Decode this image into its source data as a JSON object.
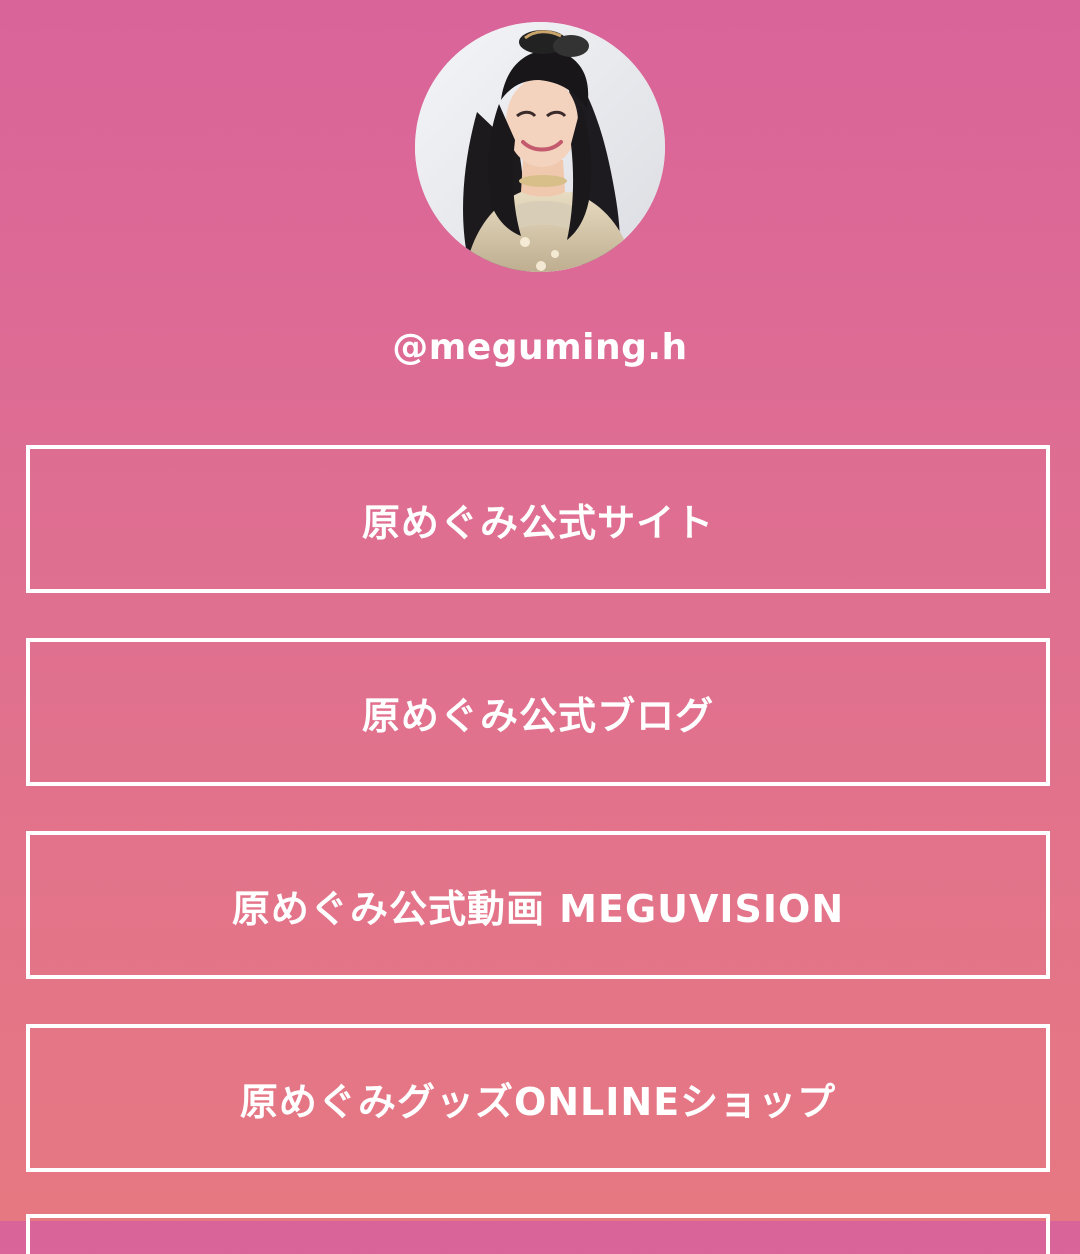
{
  "profile": {
    "username": "@meguming.h",
    "avatar": "profile-photo"
  },
  "links": [
    {
      "label": "原めぐみ公式サイト"
    },
    {
      "label": "原めぐみ公式ブログ"
    },
    {
      "label": "原めぐみ公式動画 MEGUVISION"
    },
    {
      "label": "原めぐみグッズONLINEショップ"
    }
  ],
  "colors": {
    "background_top": "#d9649a",
    "background_bottom": "#e67882",
    "button_border": "#ffffff",
    "text": "#ffffff"
  }
}
